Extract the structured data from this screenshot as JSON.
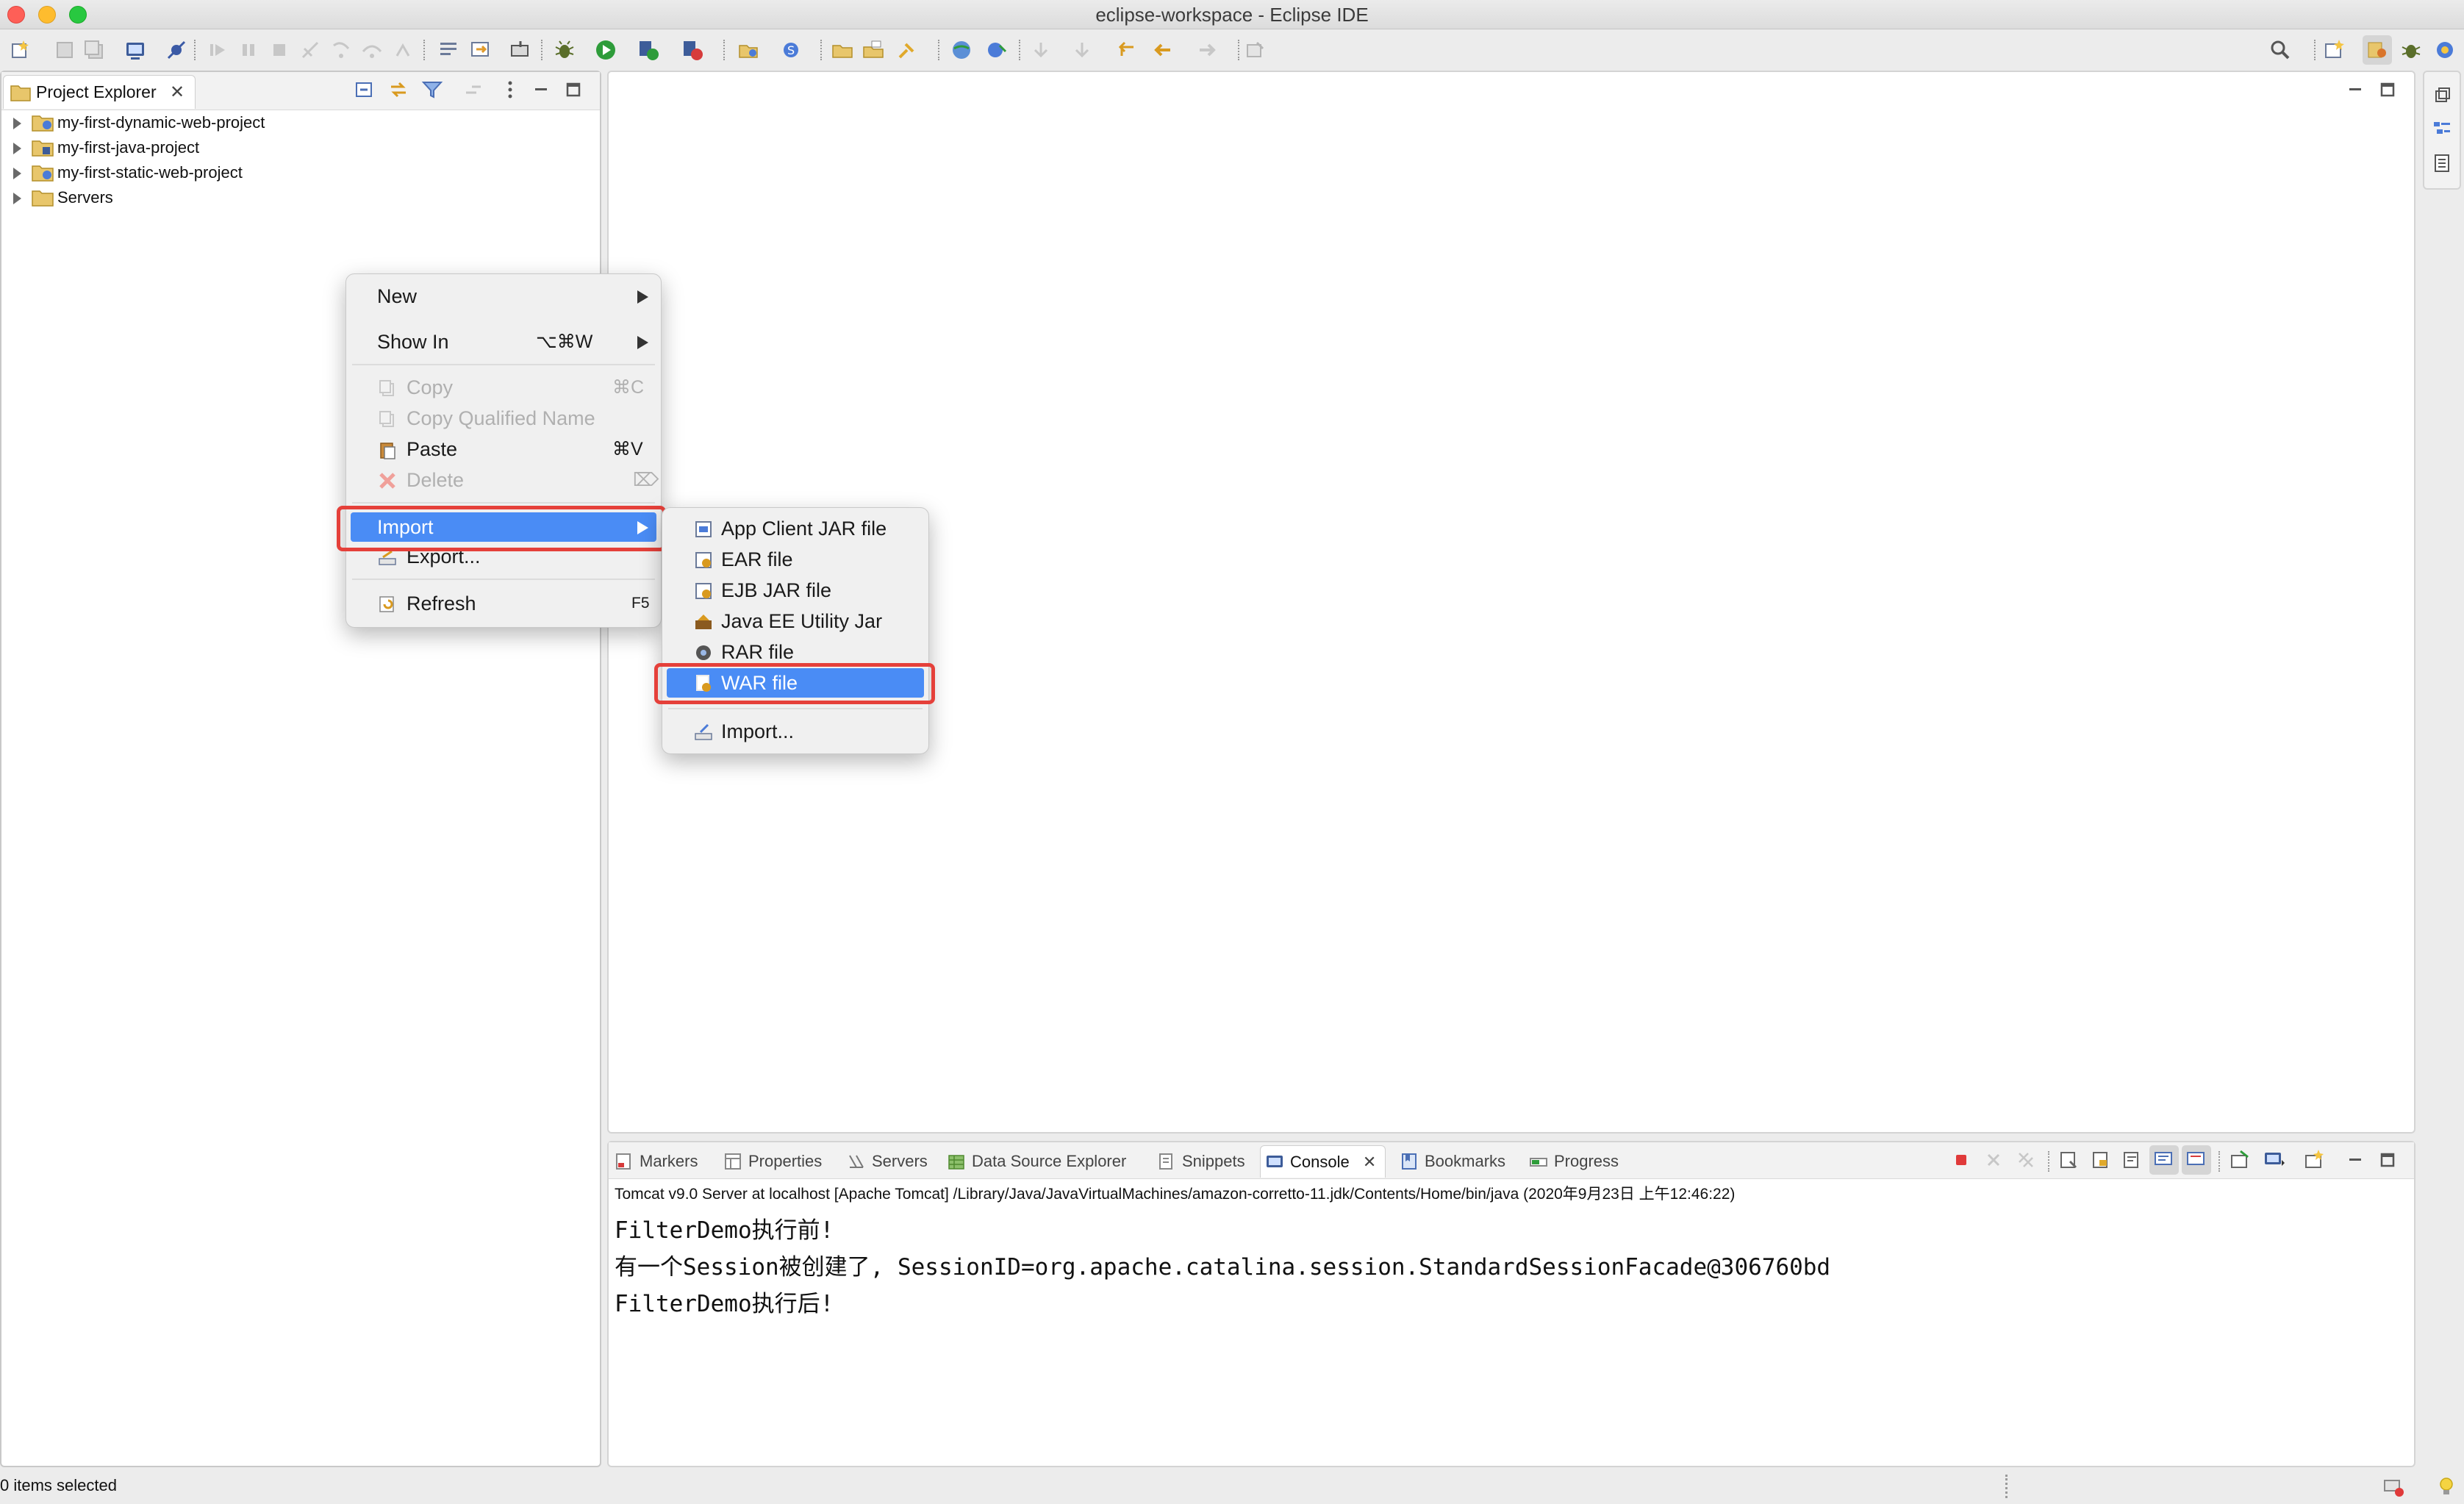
{
  "window": {
    "title": "eclipse-workspace - Eclipse IDE",
    "traffic_colors": [
      "#fe5f57",
      "#febc2e",
      "#28c840"
    ]
  },
  "toolbar": {
    "icons": [
      "new-wizard-icon",
      "save-icon",
      "save-all-icon",
      "open-console-icon",
      "skip-breakpoints-icon",
      "resume-icon",
      "suspend-icon",
      "terminate-icon",
      "disconnect-icon",
      "step-into-icon",
      "step-over-icon",
      "step-return-icon",
      "use-step-filters-icon",
      "open-type-icon",
      "debug-icon",
      "run-icon",
      "coverage-icon",
      "external-tools-icon",
      "new-java-project-icon",
      "new-server-icon",
      "open-folder-icon",
      "open-task-icon",
      "search-web-icon",
      "open-perspective-web-icon",
      "annotation-next-icon",
      "annotation-prev-icon",
      "back-icon",
      "forward-icon",
      "pin-editor-icon"
    ],
    "search_icon": "search-icon",
    "perspective_icons": [
      "open-perspective-icon",
      "java-ee-perspective-icon",
      "debug-perspective-icon",
      "git-perspective-icon"
    ]
  },
  "project_explorer": {
    "tab_label": "Project Explorer",
    "items": [
      {
        "label": "my-first-dynamic-web-project",
        "icon": "web-project-icon"
      },
      {
        "label": "my-first-java-project",
        "icon": "java-project-icon"
      },
      {
        "label": "my-first-static-web-project",
        "icon": "web-project-icon"
      },
      {
        "label": "Servers",
        "icon": "folder-icon"
      }
    ]
  },
  "context_menu": {
    "items": [
      {
        "label": "New",
        "shortcut": "",
        "submenu": true,
        "enabled": true
      },
      {
        "label": "Show In",
        "shortcut": "⌥⌘W",
        "submenu": true,
        "enabled": true
      },
      {
        "label": "Copy",
        "shortcut": "⌘C",
        "enabled": false,
        "icon": "copy-icon"
      },
      {
        "label": "Copy Qualified Name",
        "shortcut": "",
        "enabled": false,
        "icon": "copy-qualified-icon"
      },
      {
        "label": "Paste",
        "shortcut": "⌘V",
        "enabled": true,
        "icon": "paste-icon"
      },
      {
        "label": "Delete",
        "shortcut": "⌦",
        "enabled": false,
        "icon": "delete-icon"
      },
      {
        "label": "Import",
        "shortcut": "",
        "submenu": true,
        "enabled": true,
        "highlighted": true
      },
      {
        "label": "Export...",
        "shortcut": "",
        "enabled": true,
        "icon": "export-icon"
      },
      {
        "label": "Refresh",
        "shortcut": "F5",
        "enabled": true,
        "icon": "refresh-icon"
      }
    ]
  },
  "import_submenu": {
    "items": [
      {
        "label": "App Client JAR file",
        "icon": "app-client-jar-icon"
      },
      {
        "label": "EAR file",
        "icon": "ear-file-icon"
      },
      {
        "label": "EJB JAR file",
        "icon": "ejb-jar-icon"
      },
      {
        "label": "Java EE Utility Jar",
        "icon": "utility-jar-icon"
      },
      {
        "label": "RAR file",
        "icon": "rar-file-icon"
      },
      {
        "label": "WAR file",
        "icon": "war-file-icon",
        "highlighted": true
      },
      {
        "label": "Import...",
        "icon": "import-wizard-icon"
      }
    ]
  },
  "bottom_panel": {
    "tabs": [
      {
        "label": "Markers",
        "icon": "markers-icon"
      },
      {
        "label": "Properties",
        "icon": "properties-icon"
      },
      {
        "label": "Servers",
        "icon": "servers-icon"
      },
      {
        "label": "Data Source Explorer",
        "icon": "data-source-icon"
      },
      {
        "label": "Snippets",
        "icon": "snippets-icon"
      },
      {
        "label": "Console",
        "icon": "console-icon",
        "active": true
      },
      {
        "label": "Bookmarks",
        "icon": "bookmarks-icon"
      },
      {
        "label": "Progress",
        "icon": "progress-icon"
      }
    ],
    "console_header": "Tomcat v9.0 Server at localhost [Apache Tomcat] /Library/Java/JavaVirtualMachines/amazon-corretto-11.jdk/Contents/Home/bin/java  (2020年9月23日 上午12:46:22)",
    "console_lines": [
      "FilterDemo执行前!",
      "有一个Session被创建了, SessionID=org.apache.catalina.session.StandardSessionFacade@306760bd",
      "FilterDemo执行后!"
    ]
  },
  "status_bar": {
    "text": "0 items selected"
  },
  "colors": {
    "highlight": "#4a8cf5",
    "annotation_red": "#e5403a",
    "terminate_red": "#e03a3a"
  }
}
